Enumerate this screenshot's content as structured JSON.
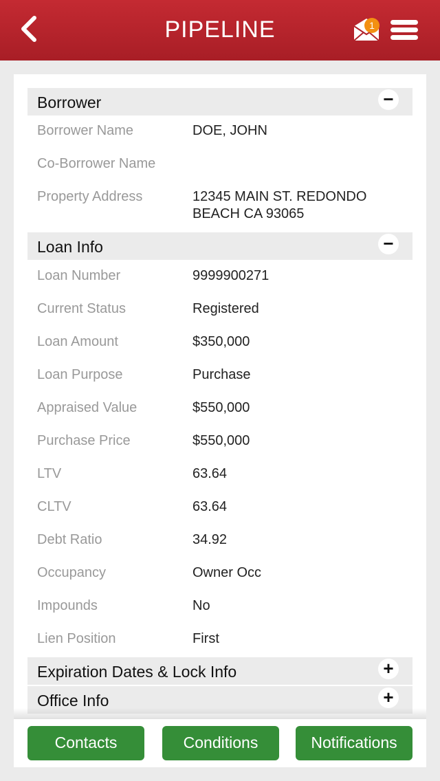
{
  "header": {
    "title": "PIPELINE",
    "badge_count": "1",
    "icons": [
      "back-chevron-icon",
      "mail-icon",
      "hamburger-menu-icon"
    ],
    "color": "#b22229"
  },
  "borrower": {
    "title": "Borrower",
    "toggle": "−",
    "rows": [
      {
        "label": "Borrower Name",
        "value": "DOE, JOHN"
      },
      {
        "label": "Co-Borrower Name",
        "value": ""
      },
      {
        "label": "Property Address",
        "value": "12345 MAIN ST. REDONDO BEACH CA 93065"
      }
    ]
  },
  "loan": {
    "title": "Loan Info",
    "toggle": "−",
    "rows": [
      {
        "label": "Loan Number",
        "value": "9999900271"
      },
      {
        "label": "Current Status",
        "value": "Registered"
      },
      {
        "label": "Loan Amount",
        "value": "$350,000"
      },
      {
        "label": "Loan Purpose",
        "value": "Purchase"
      },
      {
        "label": "Appraised Value",
        "value": "$550,000"
      },
      {
        "label": "Purchase Price",
        "value": "$550,000"
      },
      {
        "label": "LTV",
        "value": "63.64"
      },
      {
        "label": "CLTV",
        "value": "63.64"
      },
      {
        "label": "Debt Ratio",
        "value": "34.92"
      },
      {
        "label": "Occupancy",
        "value": "Owner Occ"
      },
      {
        "label": "Impounds",
        "value": "No"
      },
      {
        "label": "Lien Position",
        "value": "First"
      }
    ]
  },
  "expiration": {
    "title": "Expiration Dates & Lock Info",
    "toggle": "+"
  },
  "office": {
    "title": "Office Info",
    "toggle": "+"
  },
  "buttons": {
    "contacts": "Contacts",
    "conditions": "Conditions",
    "notifications": "Notifications",
    "color": "#358e38"
  }
}
